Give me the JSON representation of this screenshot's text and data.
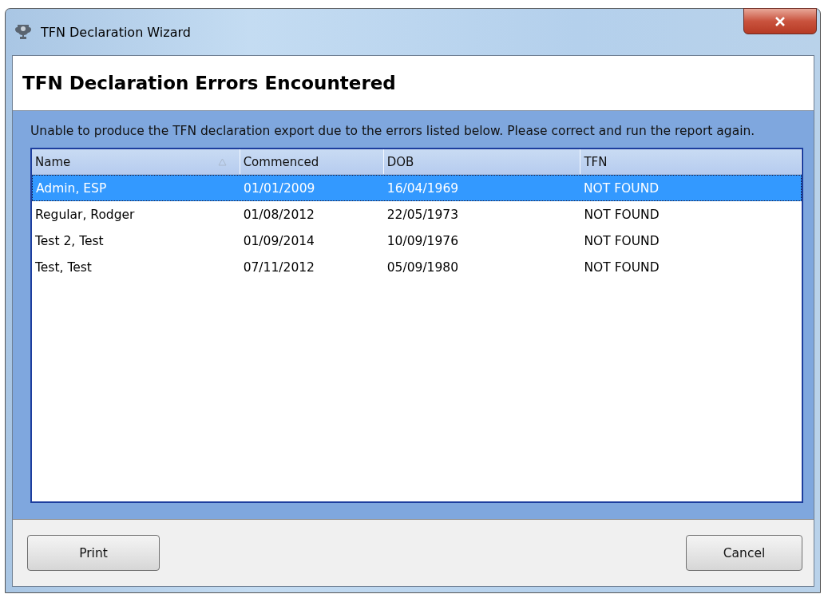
{
  "window": {
    "title": "TFN Declaration Wizard"
  },
  "heading": "TFN Declaration Errors Encountered",
  "message": "Unable to produce the TFN declaration export due to the errors listed below. Please correct and run the report again.",
  "table": {
    "columns": [
      {
        "label": "Name",
        "sorted": true
      },
      {
        "label": "Commenced",
        "sorted": false
      },
      {
        "label": "DOB",
        "sorted": false
      },
      {
        "label": "TFN",
        "sorted": false
      }
    ],
    "rows": [
      {
        "cells": [
          "Admin, ESP",
          "01/01/2009",
          "16/04/1969",
          "NOT FOUND"
        ],
        "selected": true
      },
      {
        "cells": [
          "Regular, Rodger",
          "01/08/2012",
          "22/05/1973",
          "NOT FOUND"
        ],
        "selected": false
      },
      {
        "cells": [
          "Test 2, Test",
          "01/09/2014",
          "10/09/1976",
          "NOT FOUND"
        ],
        "selected": false
      },
      {
        "cells": [
          "Test, Test",
          "07/11/2012",
          "05/09/1980",
          "NOT FOUND"
        ],
        "selected": false
      }
    ]
  },
  "buttons": {
    "left": "Print",
    "right": "Cancel"
  }
}
